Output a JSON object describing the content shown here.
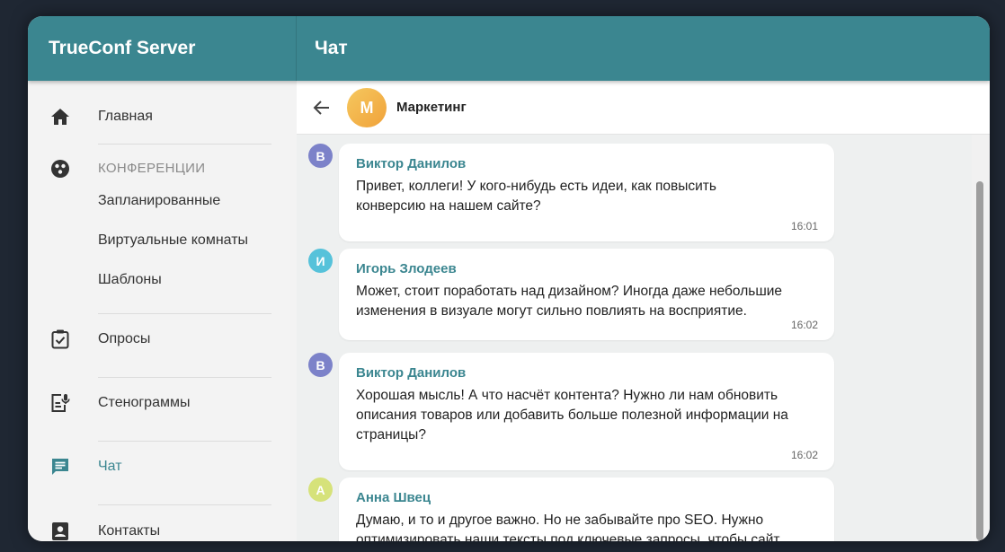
{
  "app": {
    "title": "TrueConf Server",
    "page_title": "Чат"
  },
  "sidebar": {
    "home": "Главная",
    "conferences": {
      "heading": "КОНФЕРЕНЦИИ",
      "items": [
        "Запланированные",
        "Виртуальные комнаты",
        "Шаблоны"
      ]
    },
    "polls": "Опросы",
    "transcripts": "Стенограммы",
    "chat": "Чат",
    "contacts": "Контакты"
  },
  "chat": {
    "avatar_letter": "М",
    "name": "Маркетинг",
    "messages": [
      {
        "avatar": "В",
        "avatar_color": "#7c82c9",
        "author": "Виктор Данилов",
        "lines": [
          "Привет, коллеги! У кого-нибудь есть идеи, как повысить",
          "конверсию на нашем сайте?"
        ],
        "time": "16:01"
      },
      {
        "avatar": "И",
        "avatar_color": "#56c2da",
        "author": "Игорь Злодеев",
        "lines": [
          "Может, стоит поработать над дизайном? Иногда даже небольшие",
          "изменения в визуале могут сильно повлиять на восприятие."
        ],
        "time": "16:02"
      },
      {
        "avatar": "В",
        "avatar_color": "#7c82c9",
        "author": "Виктор Данилов",
        "lines": [
          "Хорошая мысль! А что насчёт контента? Нужно ли нам обновить",
          "описания товаров или добавить больше полезной информации на",
          "страницы?"
        ],
        "time": "16:02"
      },
      {
        "avatar": "А",
        "avatar_color": "#d6e27a",
        "author": "Анна Швец",
        "lines": [
          "Думаю, и то и другое важно. Но не забывайте про SEO. Нужно",
          "оптимизировать наши тексты под ключевые запросы, чтобы сайт"
        ],
        "time": ""
      }
    ]
  },
  "colors": {
    "accent": "#3b8690",
    "avatar_orange": "#f0a23a"
  },
  "icons": [
    "home-icon",
    "conference-icon",
    "poll-icon",
    "transcript-icon",
    "chat-icon",
    "contacts-icon",
    "back-arrow-icon"
  ]
}
